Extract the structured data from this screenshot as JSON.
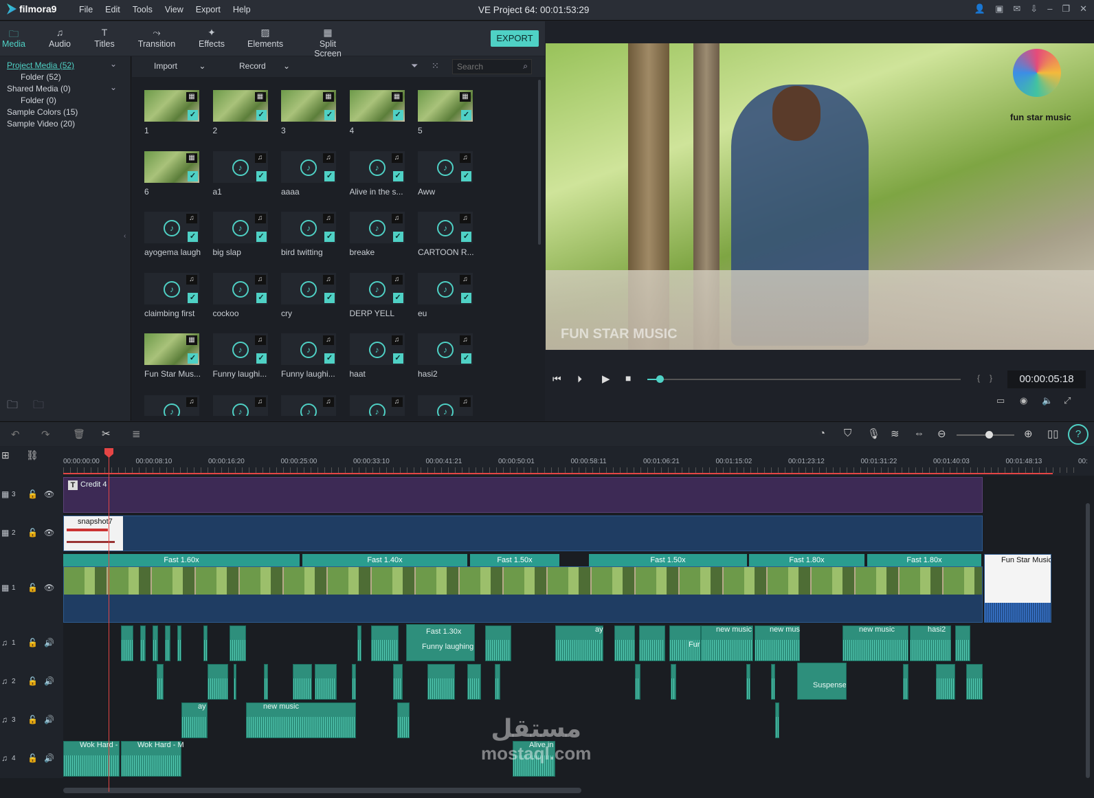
{
  "app": {
    "name": "filmora9",
    "project_title": "VE Project 64:  00:01:53:29"
  },
  "menu": [
    "File",
    "Edit",
    "Tools",
    "View",
    "Export",
    "Help"
  ],
  "tabs": [
    {
      "label": "Media",
      "icon": "folder-icon",
      "active": true
    },
    {
      "label": "Audio",
      "icon": "music-note-icon"
    },
    {
      "label": "Titles",
      "icon": "titles-icon"
    },
    {
      "label": "Transition",
      "icon": "transition-icon"
    },
    {
      "label": "Effects",
      "icon": "effects-icon"
    },
    {
      "label": "Elements",
      "icon": "image-icon"
    },
    {
      "label": "Split Screen",
      "icon": "split-screen-icon"
    }
  ],
  "export_label": "EXPORT",
  "library": [
    {
      "label": "Project Media (52)",
      "selected": true
    },
    {
      "label": "Folder (52)"
    },
    {
      "label": "Shared Media (0)"
    },
    {
      "label": "Folder (0)"
    },
    {
      "label": "Sample Colors (15)"
    },
    {
      "label": "Sample Video (20)"
    }
  ],
  "media_toolbar": {
    "import": "Import",
    "record": "Record",
    "search_placeholder": "Search"
  },
  "media_items": [
    {
      "label": "1",
      "type": "video"
    },
    {
      "label": "2",
      "type": "video"
    },
    {
      "label": "3",
      "type": "video"
    },
    {
      "label": "4",
      "type": "video"
    },
    {
      "label": "5",
      "type": "video"
    },
    {
      "label": "6",
      "type": "video"
    },
    {
      "label": "a1",
      "type": "audio"
    },
    {
      "label": "aaaa",
      "type": "audio"
    },
    {
      "label": "Alive in the s...",
      "type": "audio"
    },
    {
      "label": "Aww",
      "type": "audio"
    },
    {
      "label": "ayogema laugh",
      "type": "audio"
    },
    {
      "label": "big slap",
      "type": "audio"
    },
    {
      "label": "bird twitting",
      "type": "audio"
    },
    {
      "label": "breake",
      "type": "audio"
    },
    {
      "label": "CARTOON R...",
      "type": "audio"
    },
    {
      "label": "claimbing first",
      "type": "audio"
    },
    {
      "label": "cockoo",
      "type": "audio"
    },
    {
      "label": "cry",
      "type": "audio"
    },
    {
      "label": "DERP YELL",
      "type": "audio"
    },
    {
      "label": "eu",
      "type": "audio"
    },
    {
      "label": "Fun Star Mus...",
      "type": "video"
    },
    {
      "label": "Funny laughi...",
      "type": "audio"
    },
    {
      "label": "Funny laughi...",
      "type": "audio"
    },
    {
      "label": "haat",
      "type": "audio"
    },
    {
      "label": "hasi2",
      "type": "audio"
    }
  ],
  "preview": {
    "logo_text": "fun star music",
    "overlay_text": "FUN STAR MUSIC",
    "timecode": "00:00:05:18",
    "progress": 0.04
  },
  "ruler": [
    "00:00:00:00",
    "00:00:08:10",
    "00:00:16:20",
    "00:00:25:00",
    "00:00:33:10",
    "00:00:41:21",
    "00:00:50:01",
    "00:00:58:11",
    "00:01:06:21",
    "00:01:15:02",
    "00:01:23:12",
    "00:01:31:22",
    "00:01:40:03",
    "00:01:48:13",
    "00:"
  ],
  "tracks": {
    "v3_label": "3",
    "v2_label": "2",
    "v1_label": "1",
    "a1_label": "1",
    "a2_label": "2",
    "a3_label": "3",
    "a4_label": "4"
  },
  "clips": {
    "credit": "Credit 4",
    "snapshot": "snapshot7",
    "speed": [
      "Fast 1.60x",
      "Fast 1.40x",
      "Fast 1.50x",
      "Fast 1.50x",
      "Fast 1.80x",
      "Fast 1.80x"
    ],
    "endcard": "Fun Star Music",
    "audio": {
      "a1_fast": "Fast 1.30x",
      "a1_funny": "Funny laughing",
      "a1_ay": "ay",
      "a1_new1": "new music",
      "a1_new2": "new mus",
      "a1_new3": "new music",
      "a1_hasi": "hasi2",
      "a1_fur": "Fur",
      "a2_suspense": "Suspense",
      "a3_ay": "ay",
      "a3_new": "new music",
      "a4_wok1": "Wok Hard -",
      "a4_wok2": "Wok Hard - M",
      "a4_alive": "Alive in"
    }
  },
  "watermark": {
    "arabic": "مستقل",
    "latin": "mostaql.com"
  },
  "colors": {
    "accent": "#4fd1c5",
    "playhead": "#e54545",
    "title_track": "#3d2a55",
    "video2_track": "#1f3d63",
    "speed_bar": "#2a9d8f",
    "audio_clip": "#2e8f7c"
  }
}
